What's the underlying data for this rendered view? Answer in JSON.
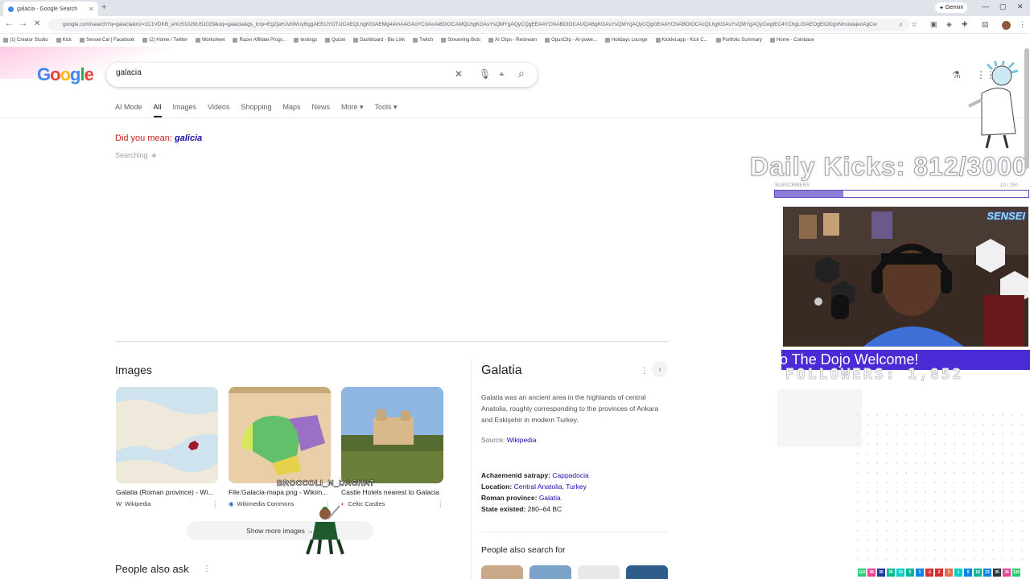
{
  "browser": {
    "tab_title": "galacia - Google Search",
    "tab_close": "×",
    "new_tab": "+",
    "gemini_label": "Gemini",
    "url": "google.com/search?q=galacia&rlz=1C1VDKB_enUS1029US1029&oq=galacia&gs_lcrp=EgZjaHJvbWUyBggAEEUYOTIJCAEQLhgKGIAEMg4IAhAAGAoYCxiAxAi8DIOCAMQLhgKGAsYsQMYgAQyCQgEEAAYChiABDIOCAUQABgKGAsYsQMYgAQyCQgGEAAYChiABDIOCAcQLhgKGAsYsQMYgAQyCwgIEC4YChgLGIAEOgEIODgxNmowajeoAgCw",
    "bookmarks": [
      "(1) Creator Studio",
      "Kick",
      "Sensei Cal | Facebook",
      "(2) Home / Twitter",
      "Worksheet",
      "Razer Affiliate Progr...",
      "testings",
      "Quizei",
      "Dashboard - Bio Link",
      "Twitch",
      "Streaming Bots",
      "AI Clips - Restream",
      "OpusClip - AI-powe...",
      "Holidays Lounge",
      "Kicklet.app - Kick C...",
      "Portfolio Summary",
      "Home - Coinbase"
    ]
  },
  "google": {
    "logo_letters": [
      "G",
      "o",
      "o",
      "g",
      "l",
      "e"
    ],
    "query": "galacia",
    "clear_icon": "✕",
    "mic_icon": "🎙",
    "lens_icon": "⌖",
    "search_icon": "⌕",
    "tabs": [
      "AI Mode",
      "All",
      "Images",
      "Videos",
      "Shopping",
      "Maps",
      "News",
      "More ▾",
      "Tools ▾"
    ],
    "did_you_mean_label": "Did you mean:",
    "did_you_mean_term": "galicia",
    "searching_text": "Searching"
  },
  "images_section": {
    "title": "Images",
    "cards": [
      {
        "caption": "Galatia (Roman province) - Wi...",
        "source": "Wikipedia"
      },
      {
        "caption": "File:Galacia-mapa.png - Wikim...",
        "source": "Wikimedia Commons"
      },
      {
        "caption": "Castle Hotels nearest to Galacia",
        "source": "Celtic Castles"
      }
    ],
    "show_more": "Show more images",
    "more_dots": "⋮"
  },
  "people_also_ask": "People also ask",
  "knowledge_panel": {
    "title": "Galatia",
    "description": "Galatia was an ancient area in the highlands of central Anatolia, roughly corresponding to the provinces of Ankara and Eskişehir in modern Turkey.",
    "source_label": "Source:",
    "source_link": "Wikipedia",
    "facts": [
      {
        "label": "Achaemenid satrapy:",
        "value": "Cappadocia",
        "link": true
      },
      {
        "label": "Location:",
        "value": "Central Anatolia, Turkey",
        "link": true
      },
      {
        "label": "Roman province:",
        "value": "Galatia",
        "link": true
      },
      {
        "label": "State existed:",
        "value": "280–64 BC",
        "link": false
      }
    ],
    "people_also_search": "People also search for"
  },
  "stream_overlay": {
    "daily_kicks": "Daily Kicks: 812/3000",
    "daily_kicks_progress": 0.27,
    "subscribers_label": "SUBSCRIBERS",
    "subscribers_count": "10 / 250",
    "sensei_tag": "SENSEI",
    "welcome_text": "o The Dojo Welcome!",
    "followers_text": "FOLLOWERS: 1,852",
    "broccoli_text": "BROCCOLI_N_DACHAT",
    "chat_chips": [
      {
        "text": "110",
        "color": "#2ecc71"
      },
      {
        "text": "38",
        "color": "#e84393"
      },
      {
        "text": "35",
        "color": "#1e3799"
      },
      {
        "text": "26",
        "color": "#00b894"
      },
      {
        "text": "10",
        "color": "#00cec9"
      },
      {
        "text": "5",
        "color": "#00b894"
      },
      {
        "text": "1",
        "color": "#0984e3"
      },
      {
        "text": "-1",
        "color": "#d63031"
      },
      {
        "text": "2",
        "color": "#d63031"
      },
      {
        "text": "1",
        "color": "#e17055"
      },
      {
        "text": "1",
        "color": "#00cec9"
      },
      {
        "text": "5",
        "color": "#0984e3"
      },
      {
        "text": "18",
        "color": "#00b894"
      },
      {
        "text": "23",
        "color": "#0984e3"
      },
      {
        "text": "35",
        "color": "#2d3436"
      },
      {
        "text": "38",
        "color": "#e84393"
      },
      {
        "text": "120",
        "color": "#2ecc71"
      }
    ]
  }
}
